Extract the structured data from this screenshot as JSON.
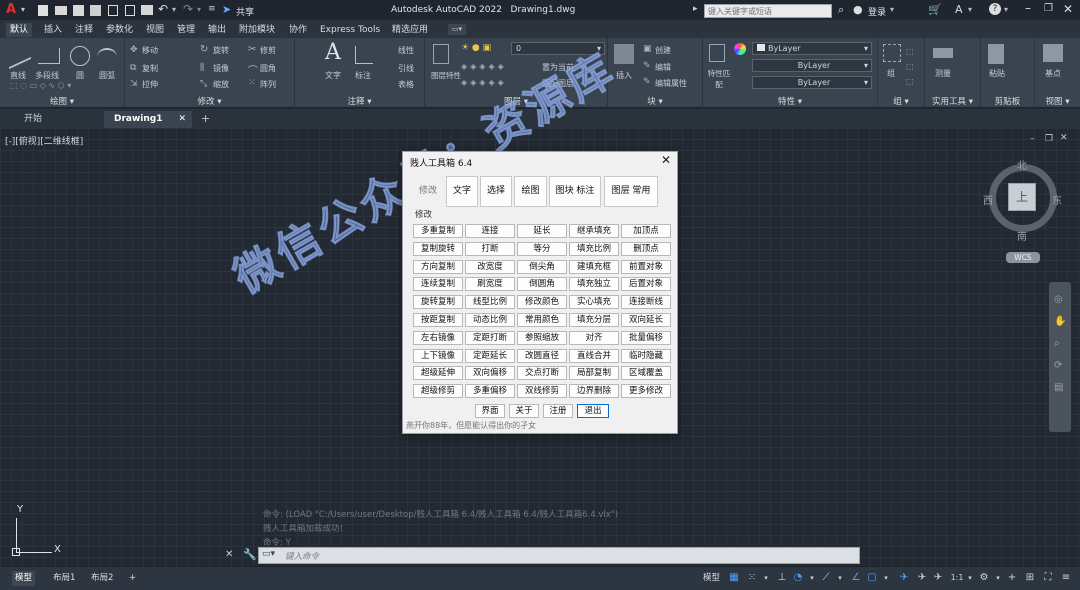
{
  "titlebar": {
    "app_title": "Autodesk AutoCAD 2022",
    "file_title": "Drawing1.dwg",
    "share_label": "共享",
    "search_placeholder": "键入关键字或短语",
    "login_label": "登录"
  },
  "menu_tabs": [
    "默认",
    "插入",
    "注释",
    "参数化",
    "视图",
    "管理",
    "输出",
    "附加模块",
    "协作",
    "Express Tools",
    "精选应用"
  ],
  "ribbon": {
    "groups": [
      "绘图",
      "修改",
      "注释",
      "图层",
      "块",
      "特性",
      "组",
      "实用工具",
      "剪贴板",
      "视图"
    ],
    "draw_tools": [
      "直线",
      "多段线",
      "圆",
      "圆弧"
    ],
    "modify_tools": [
      "移动",
      "旋转",
      "修剪",
      "复制",
      "镜像",
      "圆角",
      "拉伸",
      "缩放",
      "阵列"
    ],
    "annotate_tools": [
      "文字",
      "标注",
      "线性",
      "引线",
      "表格"
    ],
    "layer_tools": [
      "图层特性",
      "置为当前",
      "匹配图层"
    ],
    "layer_current": "0",
    "block_tools": [
      "插入",
      "创建",
      "编辑",
      "编辑属性"
    ],
    "properties_tools": [
      "特性匹配"
    ],
    "bylayer_1": "ByLayer",
    "bylayer_2": "ByLayer",
    "bylayer_3": "ByLayer",
    "group_tool": "组",
    "utility_tool": "测量",
    "clipboard_tool": "粘贴",
    "view_tool": "基点"
  },
  "doc_tabs": {
    "start": "开始",
    "drawing": "Drawing1"
  },
  "viewport_label": "[-][俯视][二维线框]",
  "viewcube": {
    "north": "北",
    "south": "南",
    "east": "东",
    "west": "西",
    "top": "上",
    "wcs": "WCS"
  },
  "watermark": "微信公众号：资源库",
  "dialog": {
    "title": "贱人工具箱 6.4",
    "tabs": [
      "修改",
      "文字",
      "选择",
      "绘图",
      "图块 标注",
      "图层 常用"
    ],
    "section": "修改",
    "buttons": [
      [
        "多重复制",
        "连接",
        "延长",
        "继承填充",
        "加顶点"
      ],
      [
        "复制旋转",
        "打断",
        "等分",
        "填充比例",
        "删顶点"
      ],
      [
        "方向复制",
        "改宽度",
        "倒尖角",
        "建填充框",
        "前置对象"
      ],
      [
        "连续复制",
        "刷宽度",
        "倒圆角",
        "填充独立",
        "后置对象"
      ],
      [
        "旋转复制",
        "线型比例",
        "修改颜色",
        "实心填充",
        "连接断线"
      ],
      [
        "按距复制",
        "动态比例",
        "常用颜色",
        "填充分层",
        "双向延长"
      ],
      [
        "左右镜像",
        "定距打断",
        "参照缩放",
        "对齐",
        "批量偏移"
      ],
      [
        "上下镜像",
        "定距延长",
        "改圆直径",
        "直线合并",
        "临时隐藏"
      ],
      [
        "超级延伸",
        "双向偏移",
        "交点打断",
        "局部复制",
        "区域覆盖"
      ],
      [
        "超级修剪",
        "多重偏移",
        "双线修剪",
        "边界删除",
        "更多修改"
      ]
    ],
    "footer_buttons": [
      "界面",
      "关于",
      "注册",
      "退出"
    ],
    "tip": "燕开你88年，但愿能认得出你的孑女"
  },
  "command_history": [
    "命令: (LOAD \"C:/Users/user/Desktop/贱人工具箱 6.4/贱人工具箱 6.4/贱人工具箱6.4.vlx\")",
    "贱人工具箱加载成功！",
    "命令: Y"
  ],
  "command_placeholder": "键入命令",
  "layout_tabs": [
    "模型",
    "布局1",
    "布局2"
  ],
  "status": {
    "model_label": "模型",
    "scale": "1:1"
  }
}
